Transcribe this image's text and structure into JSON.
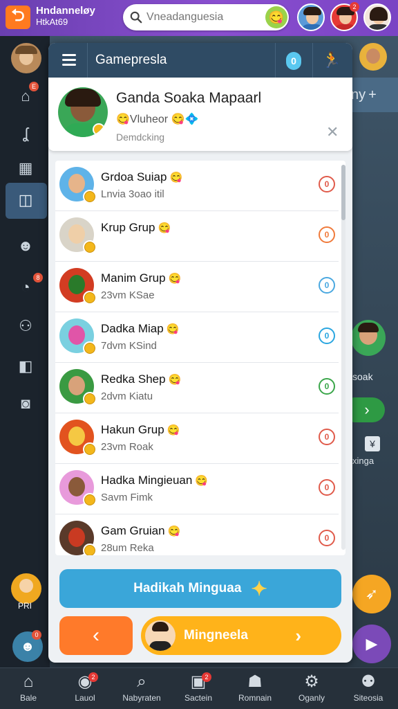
{
  "topbar": {
    "app_name_line1": "Hndanneløy",
    "app_name_line2": "HtkAt69",
    "search_placeholder": "Vneadanguesia",
    "notif_badge": "2",
    "notif_badge2": "E"
  },
  "panel": {
    "title": "Gamepresla",
    "count": "0"
  },
  "profile": {
    "name": "Ganda Soaka Mapaarl",
    "subtitle": "Vluheor",
    "status": "Demdcking"
  },
  "list": [
    {
      "title": "Grdoa Suiap",
      "sub": "Lnvia 3oao itil",
      "status": "0",
      "status_color": "#e05a4a"
    },
    {
      "title": "Krup Grup",
      "sub": "",
      "status": "0",
      "status_color": "#f07a3a"
    },
    {
      "title": "Manim Grup",
      "sub": "23vm KSae",
      "status": "0",
      "status_color": "#4aa8e0"
    },
    {
      "title": "Dadka Miap",
      "sub": "7dvm KSind",
      "status": "0",
      "status_color": "#2aa6e0"
    },
    {
      "title": "Redka Shep",
      "sub": "2dvm Kiatu",
      "status": "0",
      "status_color": "#3aa64a"
    },
    {
      "title": "Hakun Grup",
      "sub": "23vm Roak",
      "status": "0",
      "status_color": "#e05a4a"
    },
    {
      "title": "Hadka Mingieuan",
      "sub": "Savm Fimk",
      "status": "0",
      "status_color": "#e05a4a"
    },
    {
      "title": "Gam Gruian",
      "sub": "28um Reka",
      "status": "0",
      "status_color": "#e05a4a"
    }
  ],
  "buttons": {
    "primary": "Hadikah Minguaa",
    "next": "Mingneela"
  },
  "bg_right": {
    "tab_label": "ny",
    "card_label": "soak",
    "caption": "xinga"
  },
  "left_rail": {
    "bottom_label": "PRI",
    "badge_a": "E",
    "badge_b": "8",
    "badge_c": "0"
  },
  "bottomnav": [
    {
      "label": "Bale",
      "icon": "home-icon"
    },
    {
      "label": "Lauol",
      "icon": "game-icon",
      "badge": "2"
    },
    {
      "label": "Nabyraten",
      "icon": "search-icon"
    },
    {
      "label": "Sactein",
      "icon": "calendar-icon",
      "badge": "2"
    },
    {
      "label": "Romnain",
      "icon": "person-icon"
    },
    {
      "label": "Oganly",
      "icon": "gear-icon"
    },
    {
      "label": "Siteosia",
      "icon": "user-icon"
    }
  ]
}
